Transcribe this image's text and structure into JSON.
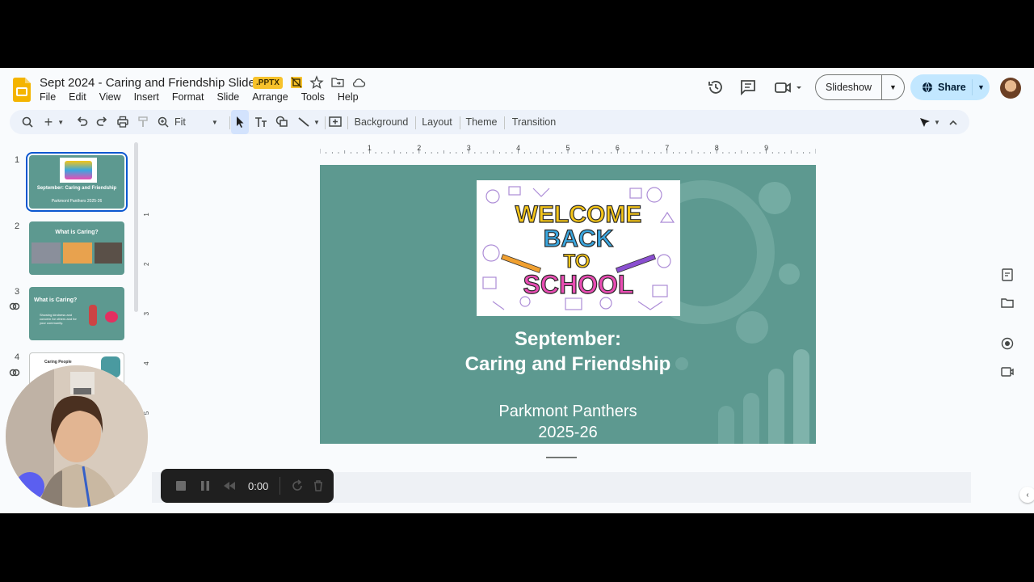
{
  "doc": {
    "title": "Sept 2024 - Caring and Friendship Slide",
    "badge": ".PPTX"
  },
  "menu": [
    "File",
    "Edit",
    "View",
    "Insert",
    "Format",
    "Slide",
    "Arrange",
    "Tools",
    "Help"
  ],
  "header": {
    "slideshow_label": "Slideshow",
    "share_label": "Share"
  },
  "toolbar": {
    "zoom": "Fit",
    "background": "Background",
    "layout": "Layout",
    "theme": "Theme",
    "transition": "Transition"
  },
  "slides": [
    {
      "num": "1",
      "title": "September: Caring and Friendship",
      "sub": "Parkmont Panthers 2025-26"
    },
    {
      "num": "2",
      "title": "What is Caring?"
    },
    {
      "num": "3",
      "title": "What is Caring?",
      "body": "Showing kindness and concern for others and for your community."
    },
    {
      "num": "4",
      "title": "Caring People"
    }
  ],
  "ruler": {
    "h_ticks": [
      "1",
      "2",
      "3",
      "4",
      "5",
      "6",
      "7",
      "8",
      "9"
    ],
    "v_ticks": [
      "1",
      "2",
      "3",
      "4",
      "5"
    ]
  },
  "canvas": {
    "banner_text": [
      "WELCOME",
      "BACK",
      "TO",
      "SCHOOL"
    ],
    "title_line1": "September:",
    "title_line2": "Caring and Friendship",
    "sub_line1": "Parkmont Panthers",
    "sub_line2": "2025-26"
  },
  "recorder": {
    "time": "0:00"
  },
  "colors": {
    "slide_bg": "#5d9990",
    "accent_blue": "#0b57d0",
    "share_bg": "#c2e7ff",
    "badge_yellow": "#f7c22b"
  }
}
